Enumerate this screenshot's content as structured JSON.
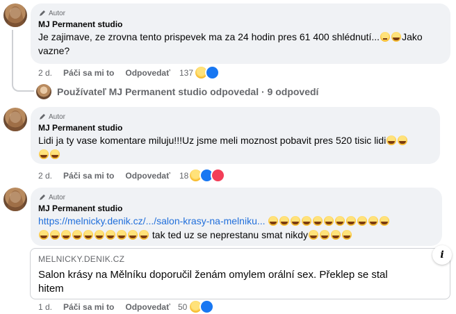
{
  "comments": [
    {
      "author_tag": "Autor",
      "name": "MJ Permanent studio",
      "text_line1": "Je zajimave, ze zrovna tento prispevek ma za 24 hodin pres 61 400 shlédnutí...",
      "text_line2": "vazne?",
      "text_tail": "Jako",
      "time": "2 d.",
      "like_label": "Páči sa mi to",
      "reply_label": "Odpovedať",
      "reaction_count": "137"
    },
    {
      "author_tag": "Autor",
      "name": "MJ Permanent studio",
      "text_line1": "Lidi ja ty vase komentare miluju!!!Uz jsme meli moznost pobavit pres 520 tisic lidi",
      "time": "2 d.",
      "like_label": "Páči sa mi to",
      "reply_label": "Odpovedať",
      "reaction_count": "18"
    },
    {
      "author_tag": "Autor",
      "name": "MJ Permanent studio",
      "link_text": "https://melnicky.denik.cz/.../salon-krasy-na-melniku...",
      "text_line2": "tak ted uz se neprestanu smat nikdy",
      "time": "1 d.",
      "like_label": "Páči sa mi to",
      "reply_label": "Odpovedať",
      "reaction_count": "50"
    }
  ],
  "replies_summary": "Používateľ MJ Permanent studio odpovedal · 9 odpovedí",
  "link_preview": {
    "domain": "MELNICKY.DENIK.CZ",
    "title": "Salon krásy na Mělníku doporučil ženám omylem orální sex. Překlep se stal hitem",
    "info_icon": "i"
  },
  "colors": {
    "bubble": "#f0f2f5",
    "link": "#216fdb",
    "muted": "#65676b",
    "like": "#1877f2",
    "love": "#f33e58",
    "haha": "#f7b928"
  }
}
